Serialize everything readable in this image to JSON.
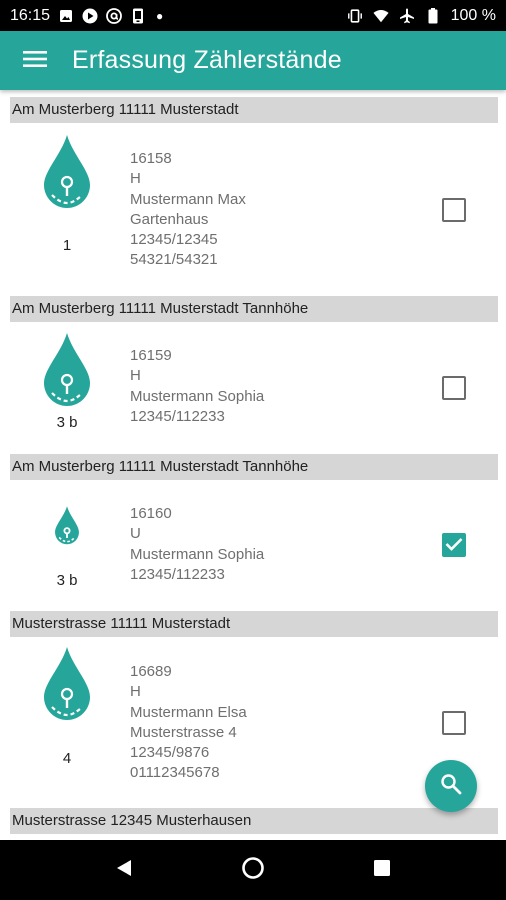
{
  "status_bar": {
    "time": "16:15",
    "battery_percent": "100 %",
    "icons_left": [
      "photo-icon",
      "play-icon",
      "at-sign-icon",
      "phone-icon",
      "dot-icon"
    ],
    "icons_right": [
      "vibrate-icon",
      "wifi-icon",
      "airplane-icon",
      "battery-icon"
    ]
  },
  "app_bar": {
    "title": "Erfassung Zählerstände",
    "menu_icon": "menu-icon"
  },
  "colors": {
    "accent": "#26a69a",
    "header_bg": "#d6d6d6",
    "detail_text": "#6f6f6f"
  },
  "groups": [
    {
      "header": "Am Musterberg 11111 Musterstadt",
      "number": "1",
      "icon": "water-drop-meter-icon",
      "checked": false,
      "lines": [
        "16158",
        "H",
        "Mustermann Max",
        "Gartenhaus",
        "12345/12345",
        "54321/54321"
      ]
    },
    {
      "header": "Am Musterberg 11111 Musterstadt Tannhöhe",
      "number": "3 b",
      "icon": "water-drop-meter-icon",
      "checked": false,
      "lines": [
        "16159",
        "H",
        "Mustermann Sophia",
        "12345/112233"
      ]
    },
    {
      "header": "Am Musterberg 11111 Musterstadt Tannhöhe",
      "number": "3 b",
      "icon": "water-drop-meter-small-icon",
      "checked": true,
      "lines": [
        "16160",
        "U",
        "Mustermann Sophia",
        "12345/112233"
      ]
    },
    {
      "header": "Musterstrasse 11111 Musterstadt",
      "number": "4",
      "icon": "water-drop-meter-icon",
      "checked": false,
      "lines": [
        "16689",
        "H",
        "Mustermann Elsa",
        "Musterstrasse 4",
        "12345/9876",
        "01112345678"
      ]
    },
    {
      "header": "Musterstrasse 12345 Musterhausen"
    }
  ],
  "fab": {
    "icon": "search-icon"
  },
  "nav_bar": {
    "icons": [
      "back-icon",
      "home-icon",
      "recents-icon"
    ]
  }
}
